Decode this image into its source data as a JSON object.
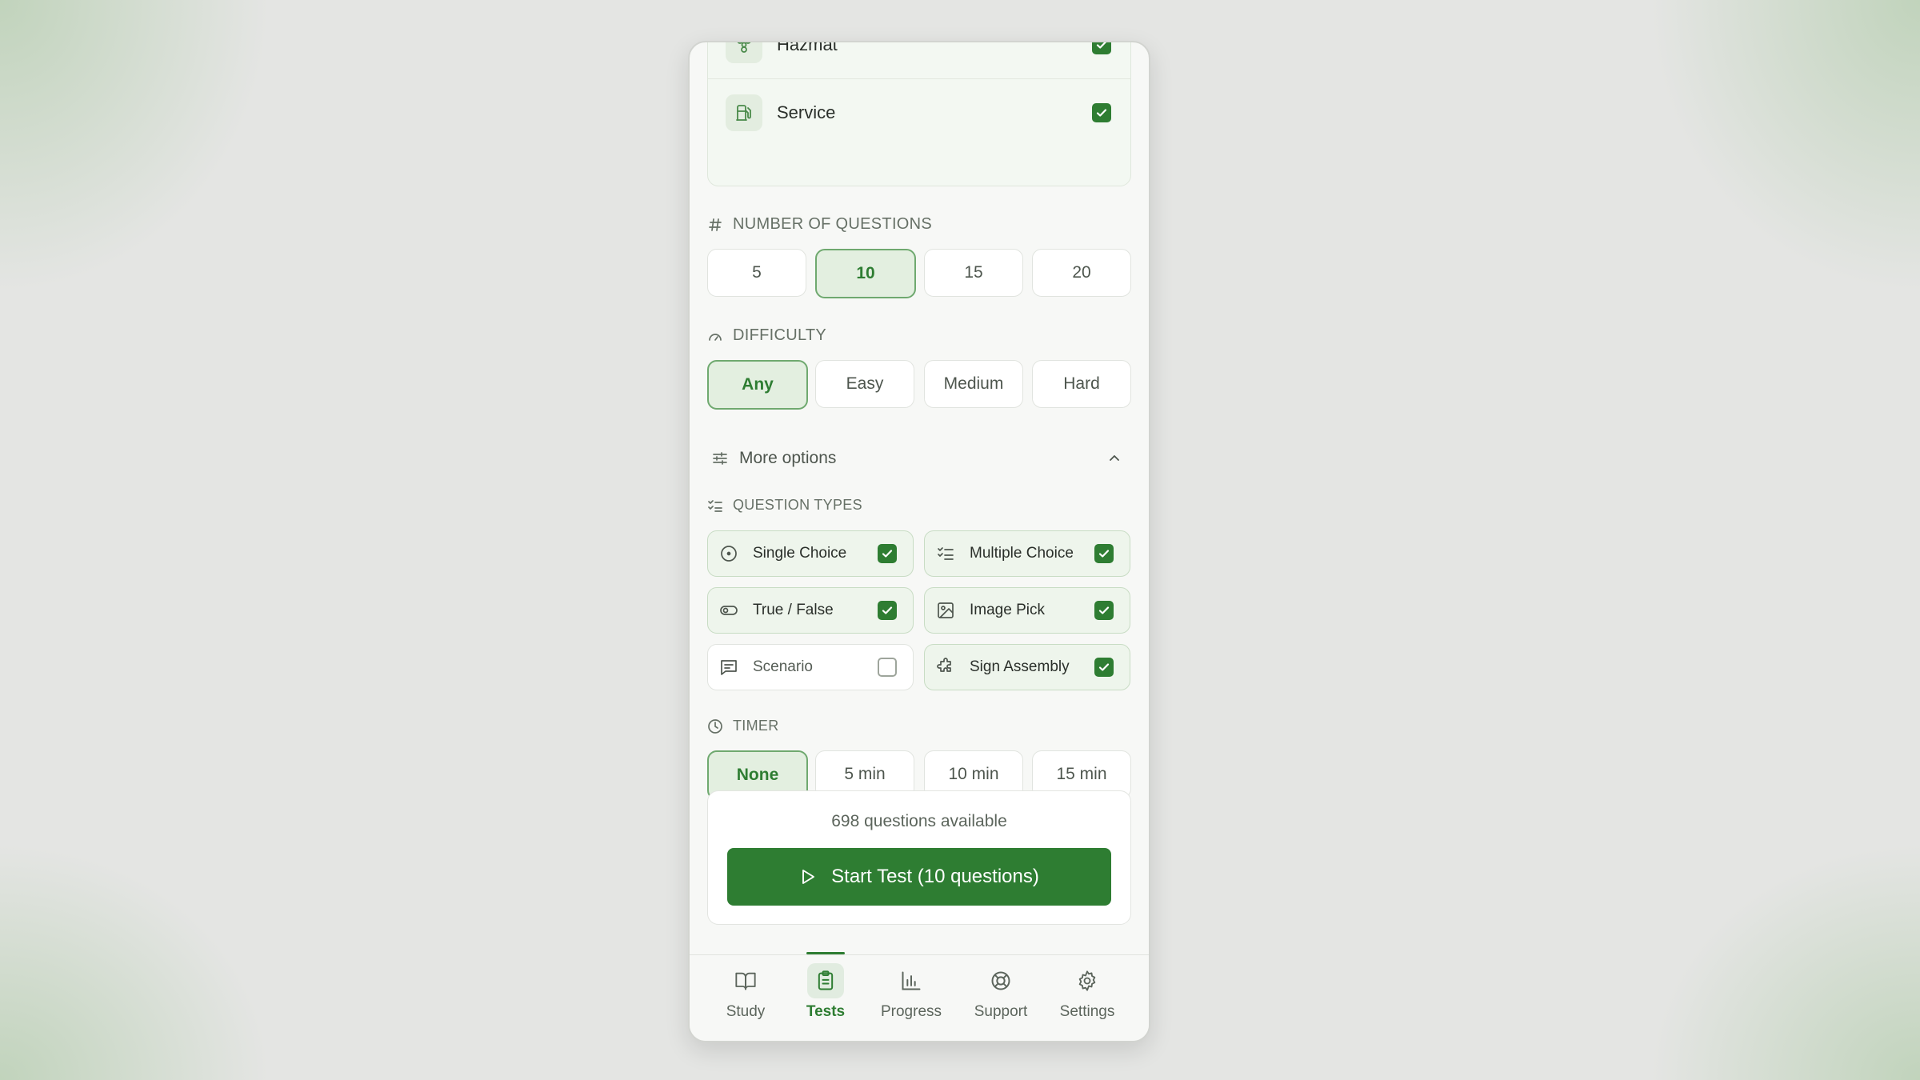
{
  "categories": [
    {
      "label": "Hazmat",
      "icon": "hazmat-icon",
      "checked": true
    },
    {
      "label": "Service",
      "icon": "fuel-pump-icon",
      "checked": true
    }
  ],
  "num_questions": {
    "title": "NUMBER OF QUESTIONS",
    "options": [
      "5",
      "10",
      "15",
      "20"
    ],
    "selected": "10"
  },
  "difficulty": {
    "title": "DIFFICULTY",
    "options": [
      "Any",
      "Easy",
      "Medium",
      "Hard"
    ],
    "selected": "Any"
  },
  "more_options": {
    "label": "More options",
    "expanded": true
  },
  "question_types": {
    "title": "QUESTION TYPES",
    "items": [
      {
        "label": "Single Choice",
        "icon": "radio-circle-icon",
        "checked": true
      },
      {
        "label": "Multiple Choice",
        "icon": "list-checks-icon",
        "checked": true
      },
      {
        "label": "True / False",
        "icon": "toggle-icon",
        "checked": true
      },
      {
        "label": "Image Pick",
        "icon": "image-icon",
        "checked": true
      },
      {
        "label": "Scenario",
        "icon": "message-square-icon",
        "checked": false
      },
      {
        "label": "Sign Assembly",
        "icon": "puzzle-icon",
        "checked": true
      }
    ]
  },
  "timer": {
    "title": "TIMER",
    "options": [
      "None",
      "5 min",
      "10 min",
      "15 min"
    ],
    "selected": "None"
  },
  "start": {
    "available_text": "698 questions available",
    "button_label": "Start Test (10 questions)"
  },
  "tabs": [
    {
      "label": "Study",
      "icon": "book-open-icon",
      "active": false
    },
    {
      "label": "Tests",
      "icon": "clipboard-list-icon",
      "active": true
    },
    {
      "label": "Progress",
      "icon": "bar-chart-icon",
      "active": false
    },
    {
      "label": "Support",
      "icon": "life-buoy-icon",
      "active": false
    },
    {
      "label": "Settings",
      "icon": "gear-icon",
      "active": false
    }
  ],
  "colors": {
    "accent": "#2e7d32",
    "accent_light": "#e3efe0",
    "background": "#f7f8f6"
  }
}
